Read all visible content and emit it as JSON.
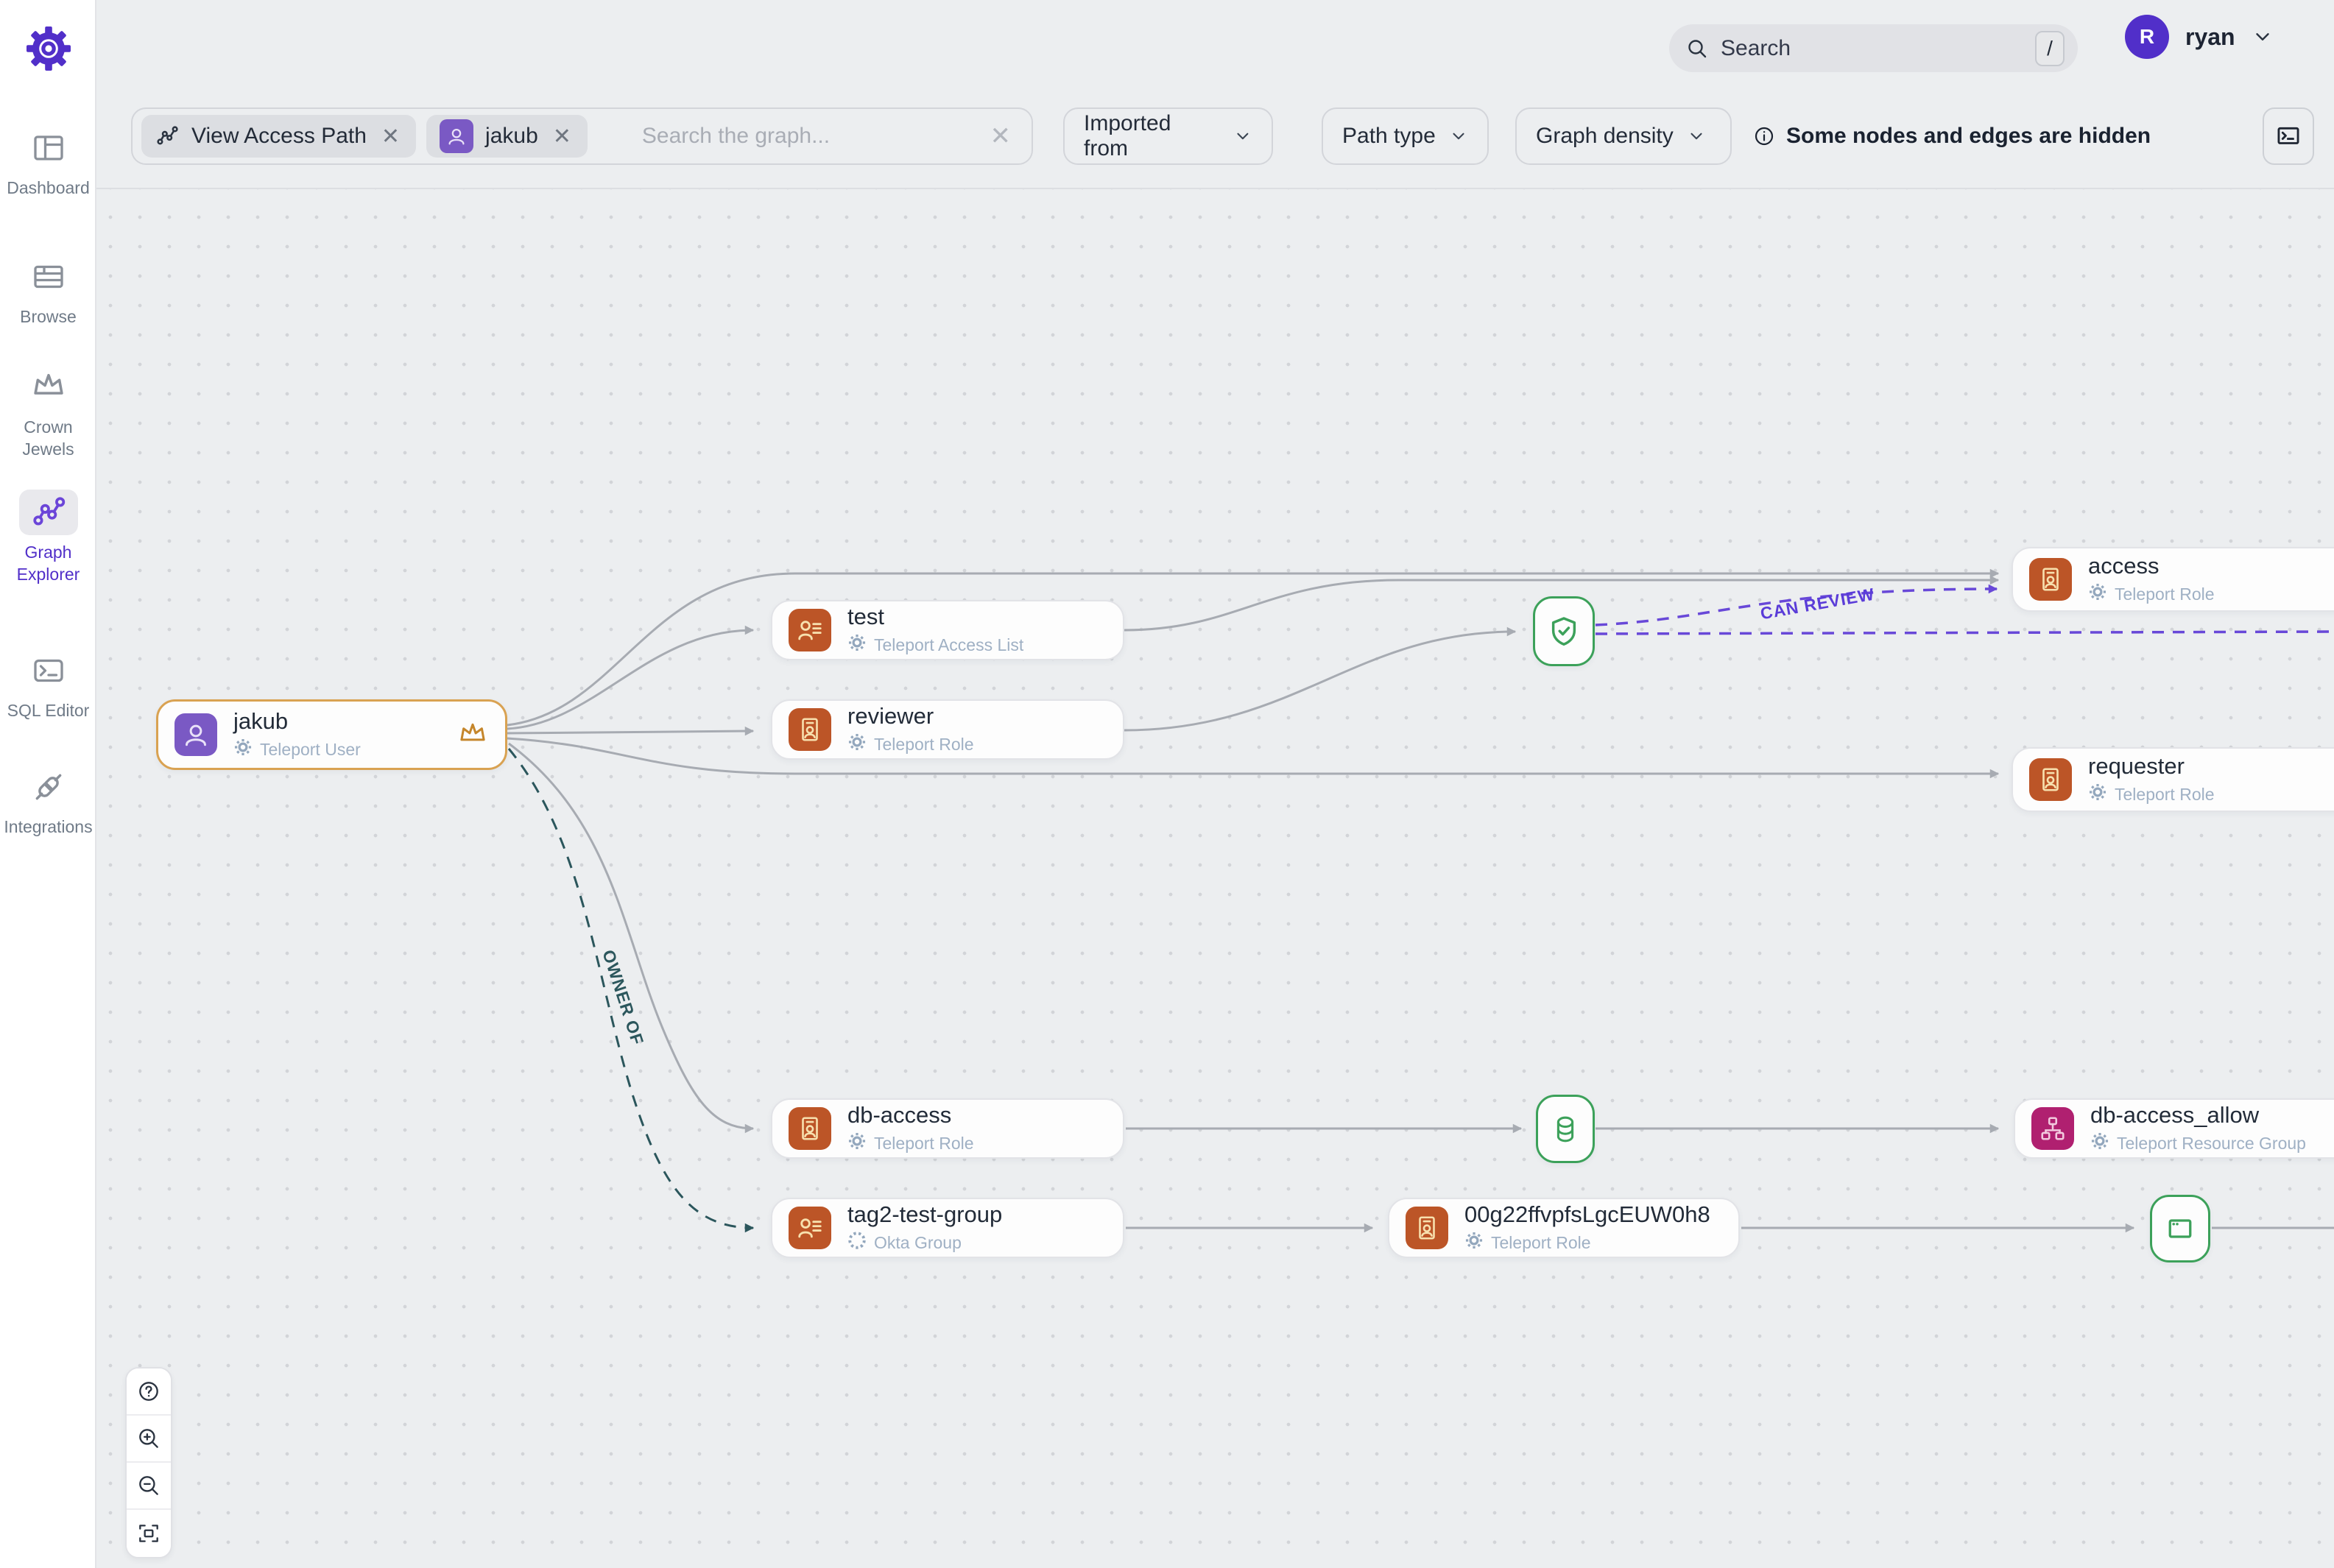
{
  "sidebar": {
    "items": [
      {
        "label": "Dashboard"
      },
      {
        "label": "Browse"
      },
      {
        "label": "Crown Jewels"
      },
      {
        "label": "Graph Explorer"
      },
      {
        "label": "SQL Editor"
      },
      {
        "label": "Integrations"
      }
    ]
  },
  "topbar": {
    "search_placeholder": "Search",
    "search_shortcut": "/",
    "user_initial": "R",
    "user_name": "ryan"
  },
  "filters": {
    "chips": [
      {
        "label": "View Access Path"
      },
      {
        "label": "jakub"
      }
    ],
    "graph_search_placeholder": "Search the graph...",
    "dropdowns": [
      {
        "label": "Imported from"
      },
      {
        "label": "Path type"
      },
      {
        "label": "Graph density"
      }
    ],
    "notice": "Some nodes and edges are hidden"
  },
  "graph": {
    "nodes": [
      {
        "title": "jakub",
        "subtitle": "Teleport User"
      },
      {
        "title": "test",
        "subtitle": "Teleport Access List"
      },
      {
        "title": "reviewer",
        "subtitle": "Teleport Role"
      },
      {
        "title": "access",
        "subtitle": "Teleport Role"
      },
      {
        "title": "requester",
        "subtitle": "Teleport Role"
      },
      {
        "title": "db-access",
        "subtitle": "Teleport Role"
      },
      {
        "title": "db-access_allow",
        "subtitle": "Teleport Resource Group"
      },
      {
        "title": "tag2-test-group",
        "subtitle": "Okta Group"
      },
      {
        "title": "00g22ffvpfsLgcEUW0h8",
        "subtitle": "Teleport Role"
      }
    ],
    "edge_labels": {
      "can_review": "CAN REVIEW",
      "owner_of": "OWNER OF"
    }
  },
  "colors": {
    "accent_purple": "#512fc9",
    "node_orange": "#bc5527",
    "node_magenta": "#b02070",
    "node_green": "#3ca15a",
    "edge_purple": "#6848d8",
    "edge_teal": "#25565c",
    "highlight_border": "#d9a252"
  }
}
